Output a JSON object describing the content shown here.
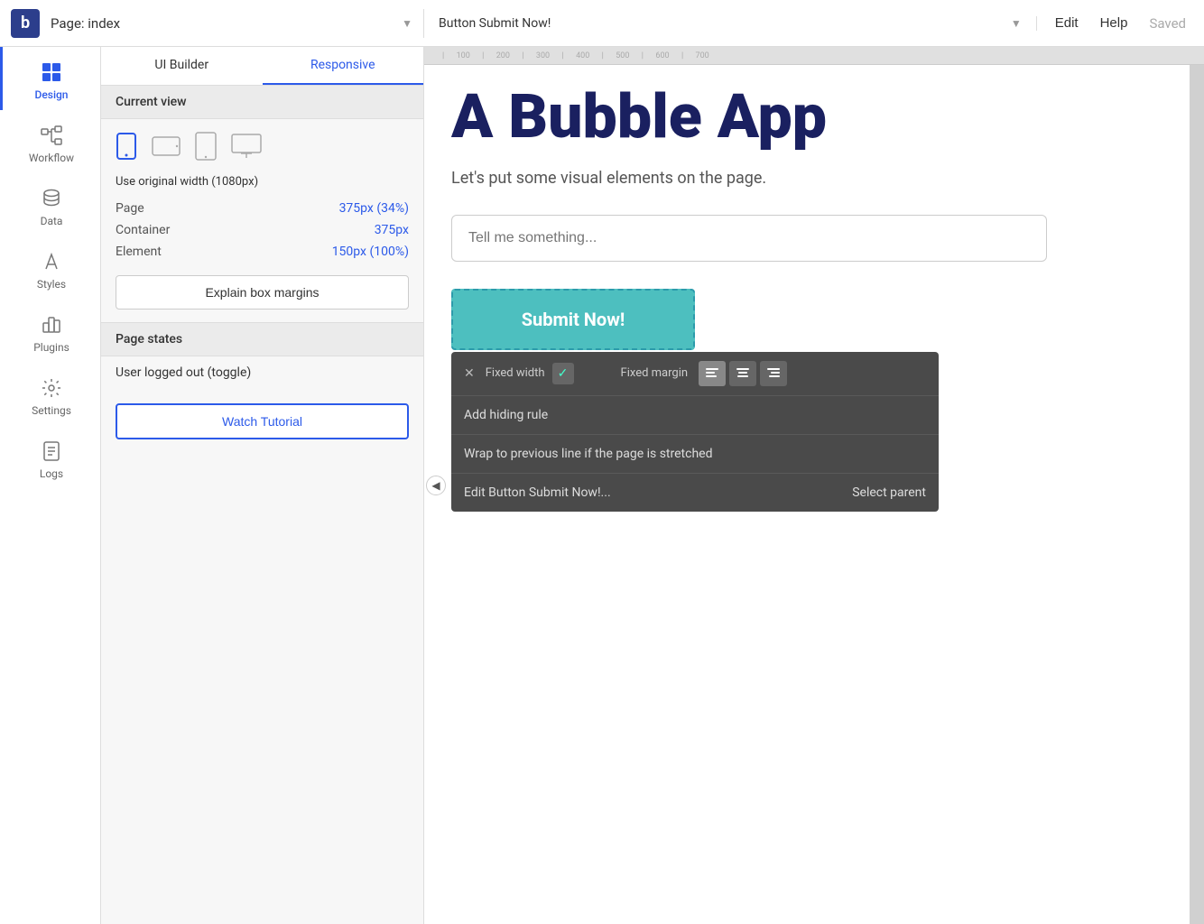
{
  "topbar": {
    "logo": "b",
    "page_title": "Page: index",
    "element_title": "Button Submit Now!",
    "edit_label": "Edit",
    "help_label": "Help",
    "saved_label": "Saved"
  },
  "sidebar": {
    "items": [
      {
        "id": "design",
        "label": "Design",
        "active": true
      },
      {
        "id": "workflow",
        "label": "Workflow",
        "active": false
      },
      {
        "id": "data",
        "label": "Data",
        "active": false
      },
      {
        "id": "styles",
        "label": "Styles",
        "active": false
      },
      {
        "id": "plugins",
        "label": "Plugins",
        "active": false
      },
      {
        "id": "settings",
        "label": "Settings",
        "active": false
      },
      {
        "id": "logs",
        "label": "Logs",
        "active": false
      }
    ]
  },
  "properties_panel": {
    "tab_ui_builder": "UI Builder",
    "tab_responsive": "Responsive",
    "current_view_label": "Current view",
    "use_original_width": "Use original width (1080px)",
    "sizes": {
      "page_label": "Page",
      "page_value": "375px (34%)",
      "container_label": "Container",
      "container_value": "375px",
      "element_label": "Element",
      "element_value": "150px (100%)"
    },
    "explain_btn": "Explain box margins",
    "page_states_header": "Page states",
    "toggle_item": "User logged out (toggle)",
    "watch_tutorial_btn": "Watch Tutorial"
  },
  "canvas": {
    "app_title": "A Bubble App",
    "subtitle": "Let's put some visual elements on the page.",
    "input_placeholder": "Tell me something...",
    "submit_btn_label": "Submit Now!"
  },
  "context_menu": {
    "fixed_width_label": "Fixed width",
    "fixed_width_checked": "✓",
    "fixed_margin_label": "Fixed margin",
    "align_left": "≡",
    "align_center": "≡",
    "align_right": "≡",
    "add_hiding_rule": "Add hiding rule",
    "wrap_line": "Wrap to previous line if the page is stretched",
    "edit_button": "Edit Button Submit Now!...",
    "select_parent": "Select parent"
  }
}
